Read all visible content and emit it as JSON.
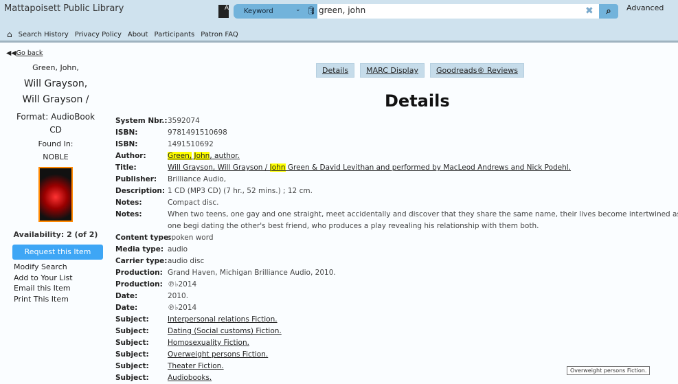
{
  "header": {
    "library_name": "Mattapoisett Public Library",
    "search_type": "Keyword",
    "search_value": "green, john",
    "advanced": "Advanced",
    "nav": [
      "Search History",
      "Privacy Policy",
      "About",
      "Participants",
      "Patron FAQ"
    ]
  },
  "go_back": "Go back",
  "sidebar": {
    "author": "Green, John,",
    "title_lines": [
      "Will Grayson,",
      "Will Grayson /"
    ],
    "format": "Format: AudioBook CD",
    "found_in_label": "Found In:",
    "found_in": "NOBLE",
    "availability": "Availability: 2 (of 2)",
    "request_button": "Request this Item",
    "links": [
      "Modify Search",
      "Add to Your List",
      "Email this Item",
      "Print This Item"
    ]
  },
  "tabs": [
    "Details",
    "MARC Display",
    "Goodreads® Reviews"
  ],
  "details_title": "Details",
  "author_parts": {
    "h1": "Green,",
    "sep": " ",
    "h2": "John",
    "rest": ", author."
  },
  "title_parts": {
    "pre": "Will Grayson, Will Grayson / ",
    "hl": "John",
    "post": " Green & David Levithan and performed by MacLeod Andrews and Nick Podehl."
  },
  "rows": [
    {
      "label": "System Nbr.:",
      "value": "3592074"
    },
    {
      "label": "ISBN:",
      "value": "9781491510698"
    },
    {
      "label": "ISBN:",
      "value": "1491510692"
    },
    {
      "label": "Author:",
      "value": ""
    },
    {
      "label": "Title:",
      "value": ""
    },
    {
      "label": "Publisher:",
      "value": "Brilliance Audio,"
    },
    {
      "label": "Description:",
      "value": "1 CD (MP3 CD) (7 hr., 52 mins.) ; 12 cm."
    },
    {
      "label": "Notes:",
      "value": "Compact disc."
    },
    {
      "label": "Notes:",
      "value": "When two teens, one gay and one straight, meet accidentally and discover that they share the same name, their lives become intertwined as one begi dating the other's best friend, who produces a play revealing his relationship with them both."
    },
    {
      "label": "Content type:",
      "value": "spoken word"
    },
    {
      "label": "Media type:",
      "value": "audio"
    },
    {
      "label": "Carrier type:",
      "value": "audio disc"
    },
    {
      "label": "Production:",
      "value": "Grand Haven, Michigan Brilliance Audio, 2010."
    },
    {
      "label": "Production:",
      "value": "℗♭2014"
    },
    {
      "label": "Date:",
      "value": "2010."
    },
    {
      "label": "Date:",
      "value": "℗♭2014"
    },
    {
      "label": "Subject:",
      "value": "Interpersonal relations Fiction.",
      "link": true
    },
    {
      "label": "Subject:",
      "value": "Dating (Social customs) Fiction.",
      "link": true
    },
    {
      "label": "Subject:",
      "value": "Homosexuality Fiction.",
      "link": true
    },
    {
      "label": "Subject:",
      "value": "Overweight persons Fiction.",
      "link": true
    },
    {
      "label": "Subject:",
      "value": "Theater Fiction.",
      "link": true
    },
    {
      "label": "Subject:",
      "value": "Audiobooks.",
      "link": true
    }
  ],
  "tooltip": "Overweight persons Fiction."
}
